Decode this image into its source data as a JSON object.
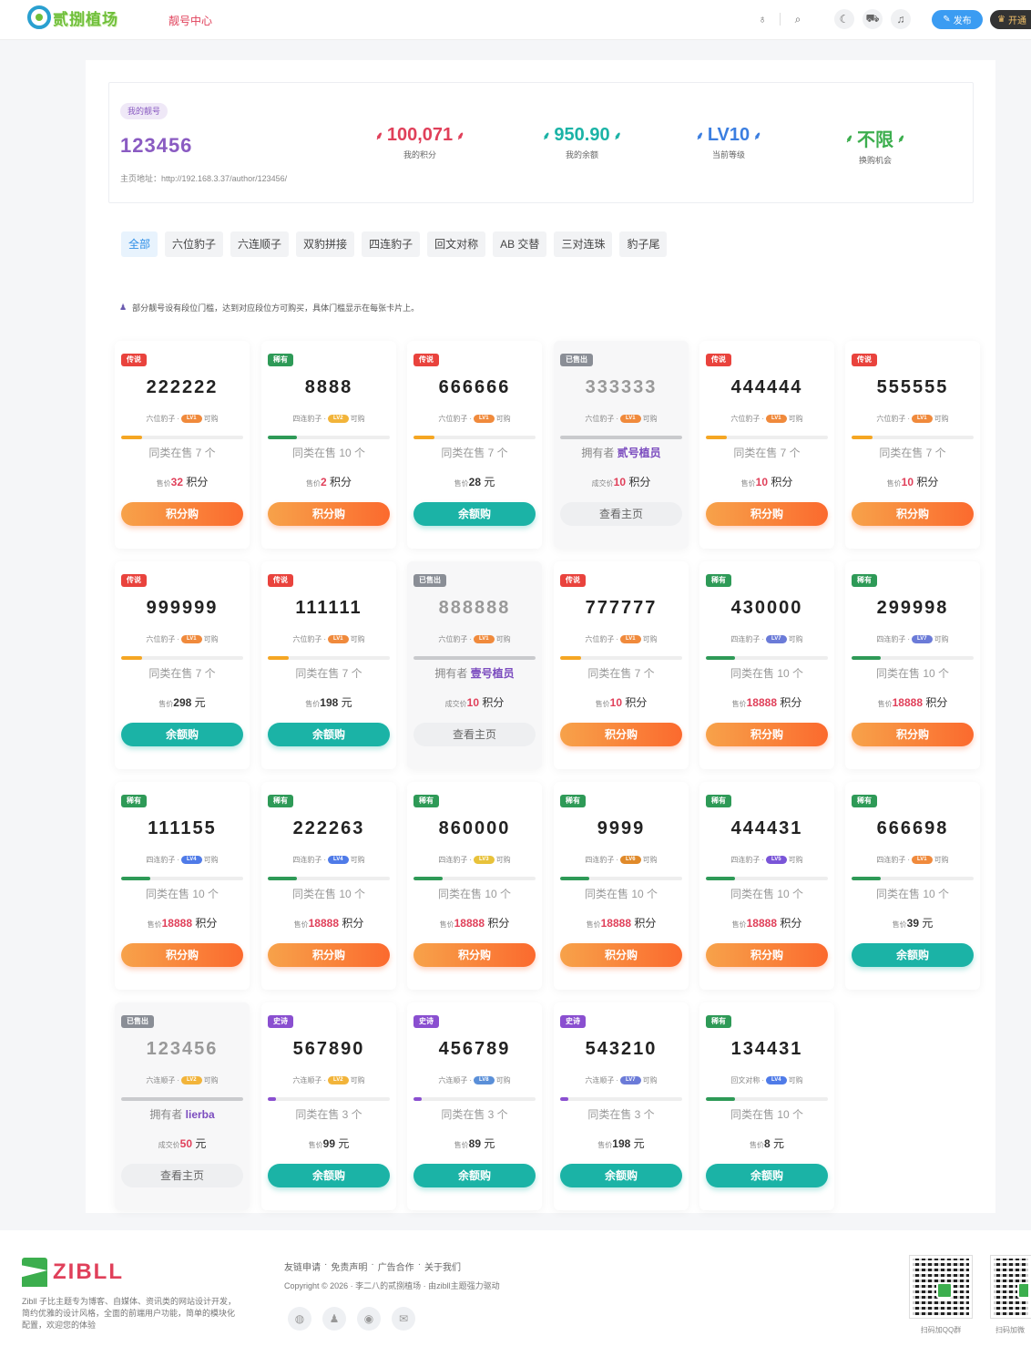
{
  "header": {
    "logo_text": "贰捌植场",
    "nav_link": "靓号中心",
    "publish_label": "发布",
    "vip_label": "开通"
  },
  "stats": {
    "tag": "我的靓号",
    "my_id": "123456",
    "homepage": "主页地址：http://192.168.3.37/author/123456/",
    "items": [
      {
        "value": "100,071",
        "label": "我的积分",
        "color": "#e0405a"
      },
      {
        "value": "950.90",
        "label": "我的余额",
        "color": "#1bb3a6"
      },
      {
        "value": "LV10",
        "label": "当前等级",
        "color": "#3b7ee0"
      },
      {
        "value": "不限",
        "label": "换购机会",
        "color": "#3cae4e"
      }
    ]
  },
  "tabs": [
    "全部",
    "六位豹子",
    "六连顺子",
    "双豹拼接",
    "四连豹子",
    "回文对称",
    "AB 交替",
    "三对连珠",
    "豹子尾"
  ],
  "notice": "部分靓号设有段位门槛，达到对应段位方可购买，具体门槛显示在每张卡片上。",
  "labels": {
    "can_buy": "可购",
    "price_prefix": "售价",
    "deal_prefix": "成交价",
    "owner_prefix": "拥有者"
  },
  "colors": {
    "传说": "#e9433d",
    "稀有": "#2e9a57",
    "已售出": "#8a8e96",
    "史诗": "#8a4fd0",
    "orange": "#fb6a2e",
    "teal": "#1bb3a6"
  },
  "cards": [
    {
      "badge": "传说",
      "number": "222222",
      "type": "六位豹子",
      "lv": "LV1",
      "same": "同类在售 7 个",
      "price": "32",
      "unit": "积分",
      "btn": "积分购",
      "btn_style": "orange",
      "fill": 0.17
    },
    {
      "badge": "稀有",
      "number": "8888",
      "type": "四连豹子",
      "lv": "LV2",
      "same": "同类在售 10 个",
      "price": "2",
      "unit": "积分",
      "btn": "积分购",
      "btn_style": "orange",
      "fill": 0.24
    },
    {
      "badge": "传说",
      "number": "666666",
      "type": "六位豹子",
      "lv": "LV1",
      "same": "同类在售 7 个",
      "price": "28",
      "unit": "元",
      "btn": "余额购",
      "btn_style": "teal",
      "fill": 0.17
    },
    {
      "badge": "已售出",
      "number": "333333",
      "type": "六位豹子",
      "lv": "LV1",
      "owner": "贰号植员",
      "price": "10",
      "unit": "积分",
      "btn": "查看主页",
      "btn_style": "grey",
      "sold": true,
      "fill": 1
    },
    {
      "badge": "传说",
      "number": "444444",
      "type": "六位豹子",
      "lv": "LV1",
      "same": "同类在售 7 个",
      "price": "10",
      "unit": "积分",
      "btn": "积分购",
      "btn_style": "orange",
      "fill": 0.17
    },
    {
      "badge": "传说",
      "number": "555555",
      "type": "六位豹子",
      "lv": "LV1",
      "same": "同类在售 7 个",
      "price": "10",
      "unit": "积分",
      "btn": "积分购",
      "btn_style": "orange",
      "fill": 0.17
    },
    {
      "badge": "传说",
      "number": "999999",
      "type": "六位豹子",
      "lv": "LV1",
      "same": "同类在售 7 个",
      "price": "298",
      "unit": "元",
      "btn": "余额购",
      "btn_style": "teal",
      "fill": 0.17
    },
    {
      "badge": "传说",
      "number": "111111",
      "type": "六位豹子",
      "lv": "LV1",
      "same": "同类在售 7 个",
      "price": "198",
      "unit": "元",
      "btn": "余额购",
      "btn_style": "teal",
      "fill": 0.17
    },
    {
      "badge": "已售出",
      "number": "888888",
      "type": "六位豹子",
      "lv": "LV1",
      "owner": "壹号植员",
      "price": "10",
      "unit": "积分",
      "btn": "查看主页",
      "btn_style": "grey",
      "sold": true,
      "fill": 1
    },
    {
      "badge": "传说",
      "number": "777777",
      "type": "六位豹子",
      "lv": "LV1",
      "same": "同类在售 7 个",
      "price": "10",
      "unit": "积分",
      "btn": "积分购",
      "btn_style": "orange",
      "fill": 0.17
    },
    {
      "badge": "稀有",
      "number": "430000",
      "type": "四连豹子",
      "lv": "LV7",
      "same": "同类在售 10 个",
      "price": "18888",
      "unit": "积分",
      "btn": "积分购",
      "btn_style": "orange",
      "fill": 0.24
    },
    {
      "badge": "稀有",
      "number": "299998",
      "type": "四连豹子",
      "lv": "LV7",
      "same": "同类在售 10 个",
      "price": "18888",
      "unit": "积分",
      "btn": "积分购",
      "btn_style": "orange",
      "fill": 0.24
    },
    {
      "badge": "稀有",
      "number": "111155",
      "type": "四连豹子",
      "lv": "LV4",
      "same": "同类在售 10 个",
      "price": "18888",
      "unit": "积分",
      "btn": "积分购",
      "btn_style": "orange",
      "fill": 0.24
    },
    {
      "badge": "稀有",
      "number": "222263",
      "type": "四连豹子",
      "lv": "LV4",
      "same": "同类在售 10 个",
      "price": "18888",
      "unit": "积分",
      "btn": "积分购",
      "btn_style": "orange",
      "fill": 0.24
    },
    {
      "badge": "稀有",
      "number": "860000",
      "type": "四连豹子",
      "lv": "LV3",
      "same": "同类在售 10 个",
      "price": "18888",
      "unit": "积分",
      "btn": "积分购",
      "btn_style": "orange",
      "fill": 0.24
    },
    {
      "badge": "稀有",
      "number": "9999",
      "type": "四连豹子",
      "lv": "LV6",
      "same": "同类在售 10 个",
      "price": "18888",
      "unit": "积分",
      "btn": "积分购",
      "btn_style": "orange",
      "fill": 0.24
    },
    {
      "badge": "稀有",
      "number": "444431",
      "type": "四连豹子",
      "lv": "LV5",
      "same": "同类在售 10 个",
      "price": "18888",
      "unit": "积分",
      "btn": "积分购",
      "btn_style": "orange",
      "fill": 0.24
    },
    {
      "badge": "稀有",
      "number": "666698",
      "type": "四连豹子",
      "lv": "LV1",
      "same": "同类在售 10 个",
      "price": "39",
      "unit": "元",
      "btn": "余额购",
      "btn_style": "teal",
      "fill": 0.24
    },
    {
      "badge": "已售出",
      "number": "123456",
      "type": "六连顺子",
      "lv": "LV2",
      "owner": "lierba",
      "price": "50",
      "unit": "元",
      "btn": "查看主页",
      "btn_style": "grey",
      "sold": true,
      "fill": 1
    },
    {
      "badge": "史诗",
      "number": "567890",
      "type": "六连顺子",
      "lv": "LV2",
      "same": "同类在售 3 个",
      "price": "99",
      "unit": "元",
      "btn": "余额购",
      "btn_style": "teal",
      "fill": 0.07
    },
    {
      "badge": "史诗",
      "number": "456789",
      "type": "六连顺子",
      "lv": "LV8",
      "same": "同类在售 3 个",
      "price": "89",
      "unit": "元",
      "btn": "余额购",
      "btn_style": "teal",
      "fill": 0.07
    },
    {
      "badge": "史诗",
      "number": "543210",
      "type": "六连顺子",
      "lv": "LV7",
      "same": "同类在售 3 个",
      "price": "198",
      "unit": "元",
      "btn": "余额购",
      "btn_style": "teal",
      "fill": 0.07
    },
    {
      "badge": "稀有",
      "number": "134431",
      "type": "回文对称",
      "lv": "LV4",
      "same": "同类在售 10 个",
      "price": "8",
      "unit": "元",
      "btn": "余额购",
      "btn_style": "teal",
      "fill": 0.24
    }
  ],
  "footer": {
    "brand": "ZIBLL",
    "desc": "Zibll 子比主题专为博客、自媒体、资讯类的网站设计开发，简约优雅的设计风格，全面的前端用户功能，简单的模块化配置，欢迎您的体验",
    "links": [
      "友链申请",
      "免责声明",
      "广告合作",
      "关于我们"
    ],
    "copyright": "Copyright © 2026 · 李二八的贰捌植场 · 由zibll主题强力驱动",
    "qr_labels": [
      "扫码加QQ群",
      "扫码加微"
    ]
  }
}
